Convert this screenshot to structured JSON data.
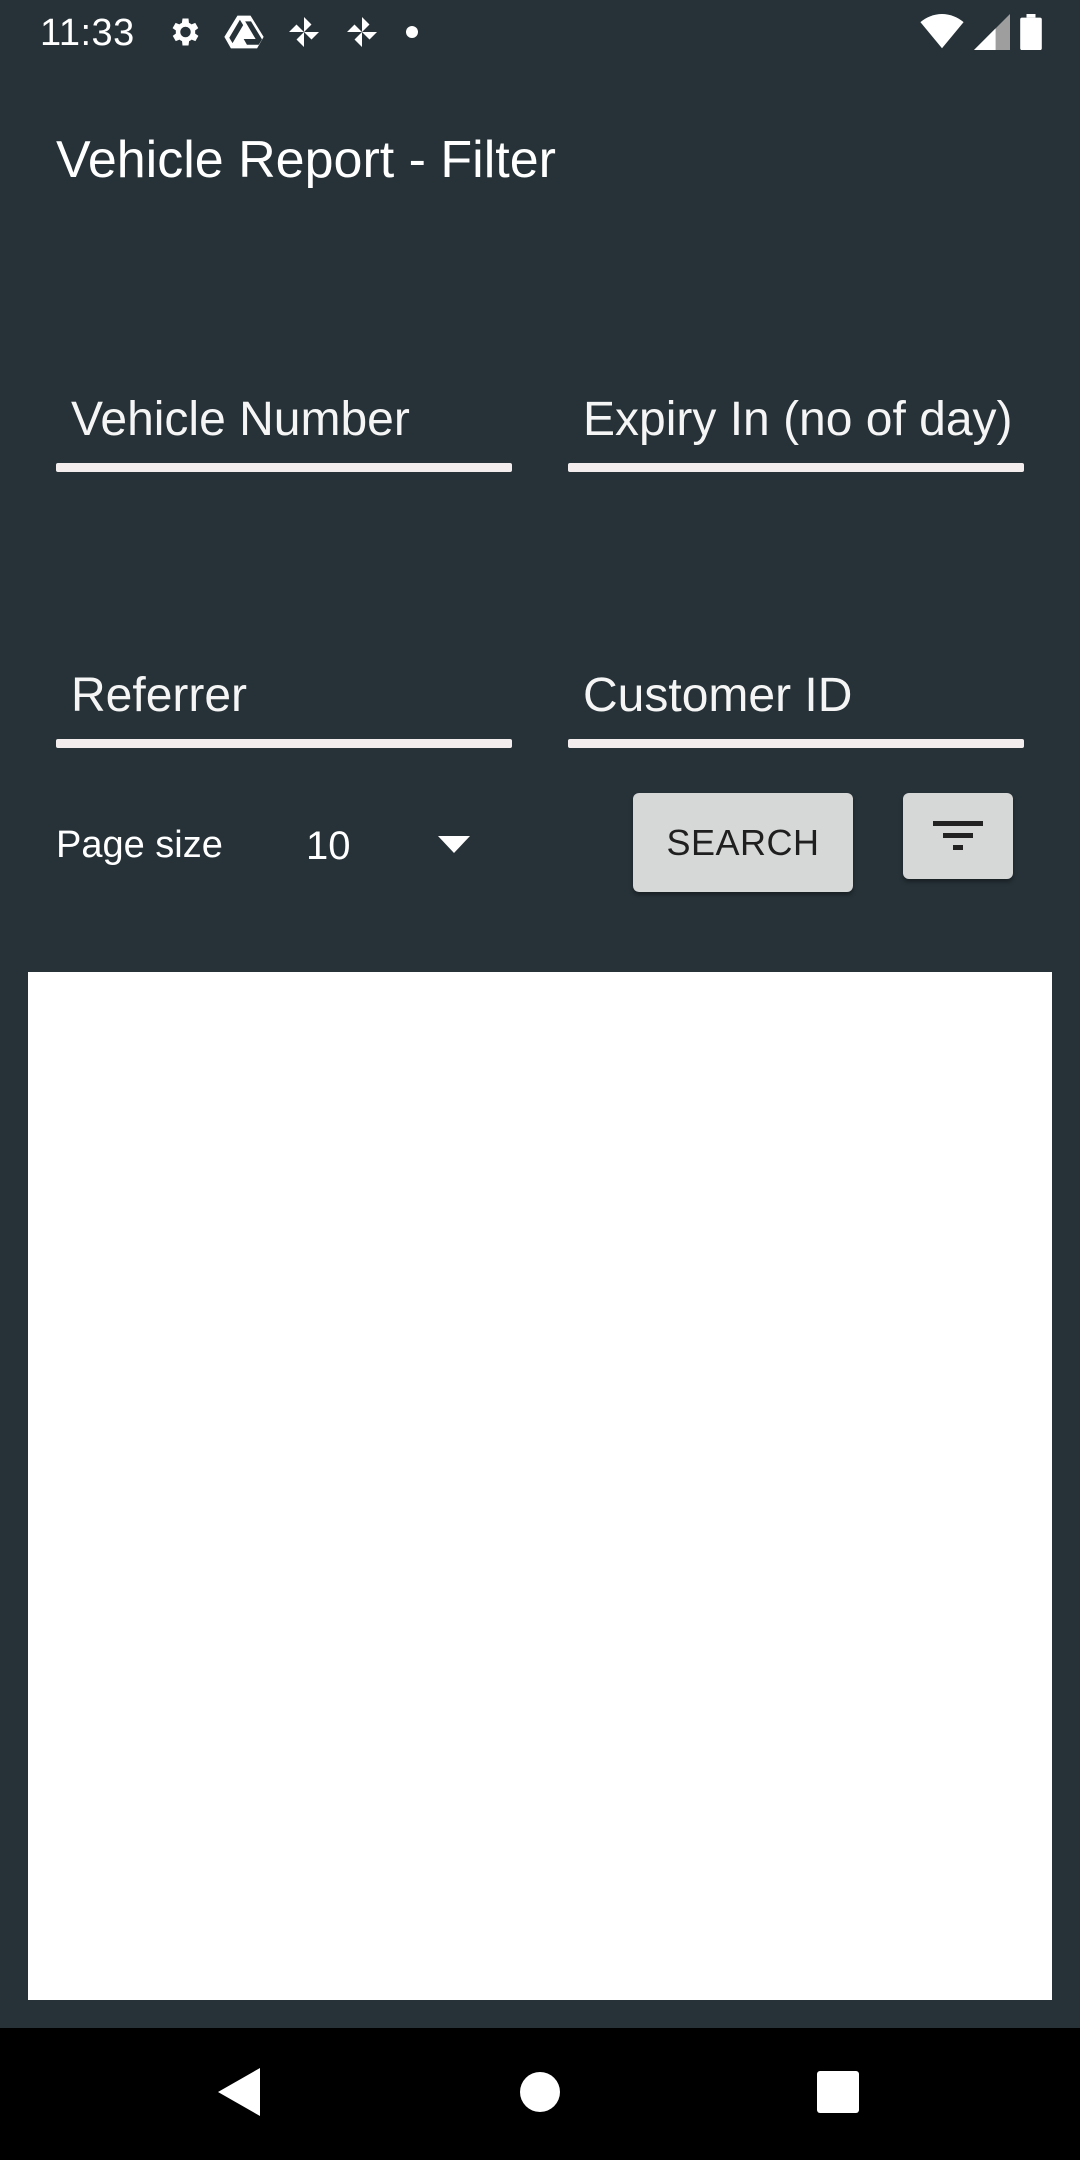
{
  "status_bar": {
    "time": "11:33",
    "left_icons": [
      "settings-icon",
      "drive-icon",
      "pinwheel-icon",
      "pinwheel-icon",
      "dot-icon"
    ],
    "right_icons": [
      "wifi-icon",
      "signal-icon",
      "battery-icon"
    ]
  },
  "page": {
    "title": "Vehicle Report - Filter"
  },
  "filters": {
    "vehicle_number": {
      "placeholder": "Vehicle Number",
      "value": ""
    },
    "expiry_in": {
      "placeholder": "Expiry In (no of day)",
      "value": ""
    },
    "referrer": {
      "placeholder": "Referrer",
      "value": ""
    },
    "customer_id": {
      "placeholder": "Customer ID",
      "value": ""
    }
  },
  "page_size": {
    "label": "Page size",
    "selected": "10"
  },
  "actions": {
    "search_label": "SEARCH",
    "filter_icon": "filter-list-icon"
  },
  "nav_bar": {
    "icons": [
      "back-icon",
      "home-icon",
      "recents-icon"
    ]
  },
  "colors": {
    "background": "#263238",
    "field_underline": "#f3eded",
    "button_bg": "#d6d7d7",
    "panel_bg": "#ffffff"
  }
}
